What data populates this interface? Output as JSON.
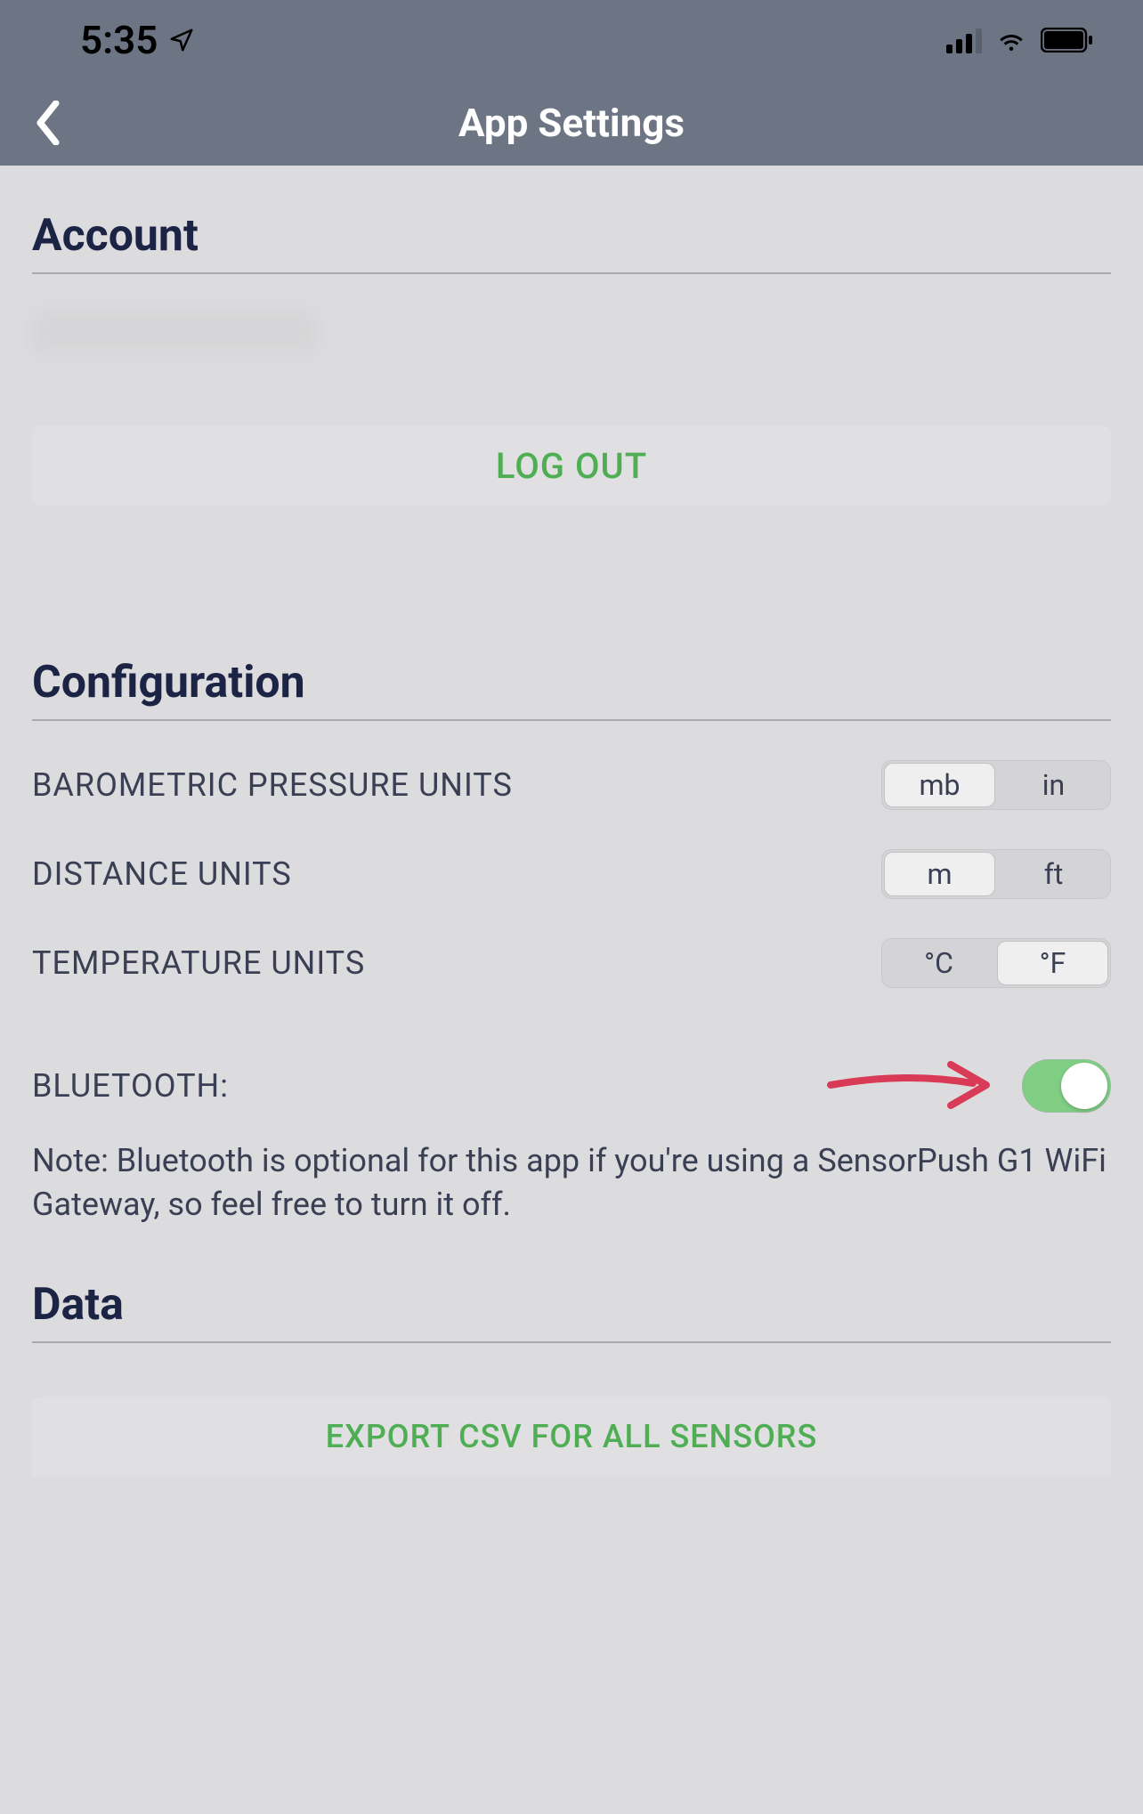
{
  "status_bar": {
    "time": "5:35"
  },
  "nav": {
    "title": "App Settings"
  },
  "account": {
    "section_title": "Account",
    "logout_label": "LOG OUT"
  },
  "configuration": {
    "section_title": "Configuration",
    "barometric": {
      "label": "BAROMETRIC PRESSURE UNITS",
      "options": [
        "mb",
        "in"
      ],
      "selected_index": 0
    },
    "distance": {
      "label": "DISTANCE UNITS",
      "options": [
        "m",
        "ft"
      ],
      "selected_index": 0
    },
    "temperature": {
      "label": "TEMPERATURE UNITS",
      "options": [
        "°C",
        "°F"
      ],
      "selected_index": 1
    },
    "bluetooth": {
      "label": "BLUETOOTH:",
      "enabled": true,
      "note": "Note: Bluetooth is optional for this app if you're using a SensorPush G1 WiFi Gateway, so feel free to turn it off."
    }
  },
  "data_section": {
    "section_title": "Data",
    "export_label": "EXPORT CSV FOR ALL SENSORS"
  }
}
